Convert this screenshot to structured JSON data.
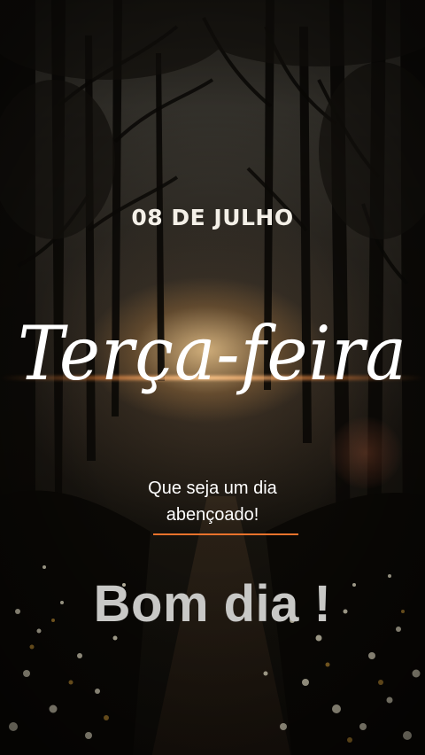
{
  "date_label": "08 DE JULHO",
  "weekday": "Terça-feira",
  "blessing": {
    "line1": "Que seja um dia",
    "line2": "abençoado!"
  },
  "greeting": "Bom dia !",
  "colors": {
    "accent_underline": "#e9722c",
    "text_white": "#ffffff",
    "greeting_gray": "#c8c8c6"
  }
}
